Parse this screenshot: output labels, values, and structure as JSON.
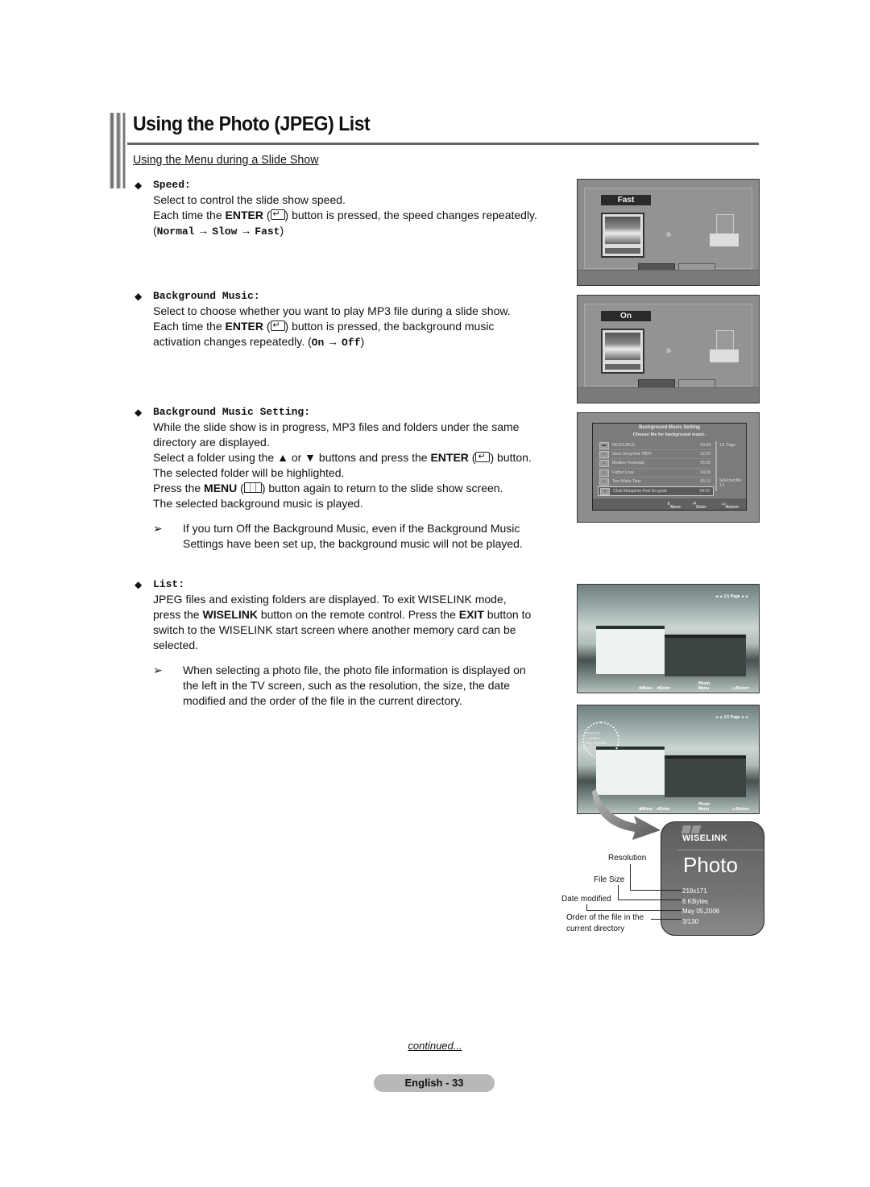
{
  "header": {
    "title": "Using the Photo (JPEG) List",
    "subtitle": "Using the Menu during a Slide Show"
  },
  "sections": {
    "speed": {
      "label": "Speed:",
      "line1": "Select to control the slide show speed.",
      "line2_pre": "Each time the ",
      "line2_key": "ENTER",
      "line2_post": ") button is pressed, the speed changes repeatedly.",
      "cycle": [
        "Normal",
        "Slow",
        "Fast"
      ],
      "screen_tag": "Fast"
    },
    "background_music": {
      "label": "Background Music:",
      "line1": "Select to choose whether you want to play MP3 file during a slide show.",
      "line2_pre": "Each time the ",
      "line2_key": "ENTER",
      "line2_post": ") button is pressed, the background music",
      "line3": "activation changes repeatedly. (",
      "cycle": [
        "On",
        "Off"
      ],
      "screen_tag": "On"
    },
    "background_music_setting": {
      "label": "Background Music Setting:",
      "line1": "While the slide show is in progress, MP3 files and folders under the same",
      "line2": "directory are displayed.",
      "line3_pre": "Select a folder using the ▲ or ▼ buttons and press the ",
      "line3_key": "ENTER",
      "line3_post": ") button.",
      "line4": "The selected folder will be highlighted.",
      "line5_pre": "Press the ",
      "line5_key": "MENU",
      "line5_post": ") button again to return to the slide show screen.",
      "line6": "The selected background music is played.",
      "note1": "If you turn Off the Background Music, even if the Background Music",
      "note2": "Settings have been set up, the background music will not be played.",
      "screen": {
        "title": "Background Music Setting",
        "subtitle": "Choose file for background music.",
        "rows": [
          {
            "icon": "folder-icon",
            "name": "RESOURCE",
            "time": "03:48"
          },
          {
            "icon": "music-note-icon",
            "name": "Sean Song feat TBNY",
            "time": "02:20"
          },
          {
            "icon": "music-note-icon",
            "name": "Beatles-Yesterday",
            "time": "05:30"
          },
          {
            "icon": "music-note-icon",
            "name": "Father Love",
            "time": "04:28"
          },
          {
            "icon": "music-note-icon",
            "name": "Tom Waits-Time",
            "time": "05:10"
          },
          {
            "icon": "music-note-icon",
            "name": "Chuk Mangione-Feel So good",
            "time": "04:20",
            "selected": true
          }
        ],
        "page": "1/1 Page",
        "selected_file_label": "Selected file",
        "selected_file_value": "1:1",
        "footer": {
          "move": "Move",
          "enter": "Enter",
          "return": "Return"
        }
      }
    },
    "list": {
      "label": "List:",
      "line1": "JPEG files and existing folders are displayed. To exit WISELINK mode,",
      "line2_pre": "press the ",
      "line2_key": "WISELINK",
      "line2_mid": " button on the remote control. Press the ",
      "line2_key2": "EXIT",
      "line2_post": " button to",
      "line3": "switch to the WISELINK start screen where another memory card can be",
      "line4": "selected.",
      "note1": "When selecting a photo file, the photo file information is displayed on",
      "note2": "the left in the TV screen, such as the resolution, the size, the date",
      "note3": "modified and the order of the file in the current directory.",
      "screen": {
        "pager": "◄◄ 1/1 Page ►►",
        "footer": {
          "move": "Move",
          "enter": "Enter",
          "photo_menu": "Photo Menu",
          "return": "Return"
        }
      }
    }
  },
  "info_card": {
    "brand": "WISELINK",
    "mode": "Photo",
    "values": [
      "219x171",
      "6 KBytes",
      "May 05,2006",
      "3/130"
    ],
    "callouts": {
      "resolution": "Resolution",
      "file_size": "File Size",
      "date_modified": "Date modified",
      "order1": "Order of the file in the",
      "order2": "current directory"
    }
  },
  "footer": {
    "continued": "continued...",
    "page_label": "English - 33"
  }
}
